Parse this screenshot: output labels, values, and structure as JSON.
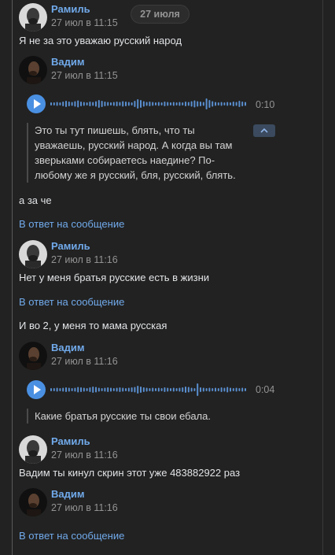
{
  "date_divider": "27 июля",
  "messages": [
    {
      "author": "Рамиль",
      "time": "27 июл в 11:15",
      "text": "Я не за это уважаю русский народ"
    },
    {
      "author": "Вадим",
      "time": "27 июл в 11:15",
      "voice": {
        "duration": "0:10",
        "transcript": [
          "Это ты тут пишешь, блять, что ты",
          "уважаешь, русский народ. А когда вы там",
          "зверьками собираетесь наедине? По-",
          "любому же я русский, бля, русский, блять."
        ]
      },
      "text": "а за че",
      "reply_link": "В ответ на сообщение"
    },
    {
      "author": "Рамиль",
      "time": "27 июл в 11:16",
      "text": "Нет у меня братья русские есть в жизни",
      "reply_link": "В ответ на сообщение",
      "text2": "И во 2, у меня то мама русская"
    },
    {
      "author": "Вадим",
      "time": "27 июл в 11:16",
      "voice": {
        "duration": "0:04",
        "transcript": [
          "Какие братья русские ты свои ебала."
        ]
      }
    },
    {
      "author": "Рамиль",
      "time": "27 июл в 11:16",
      "text": "Вадим ты кинул скрин этот уже 483882922 раз"
    },
    {
      "author": "Вадим",
      "time": "27 июл в 11:16",
      "reply_link": "В ответ на сообщение"
    }
  ],
  "colors": {
    "background": "#222222",
    "link": "#71aaeb",
    "accent": "#4a90e2",
    "muted": "#939393"
  }
}
